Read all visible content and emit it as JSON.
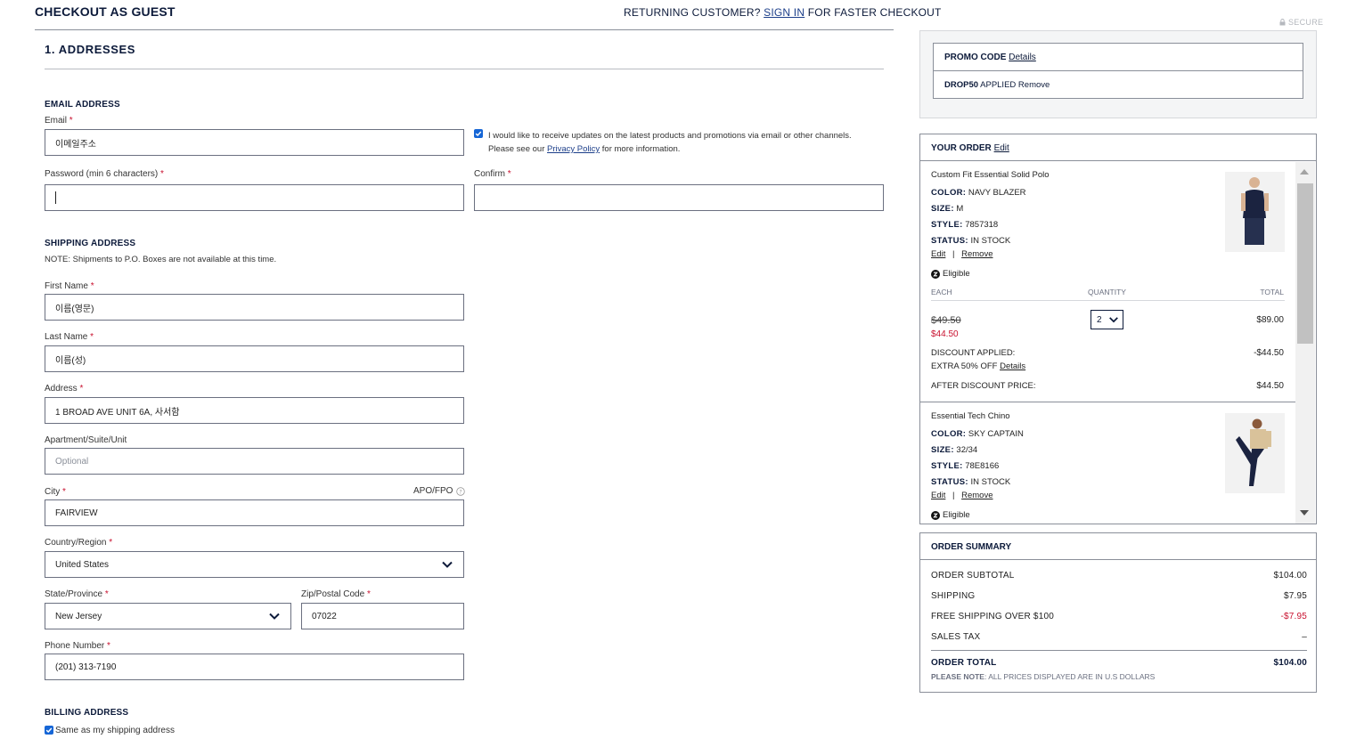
{
  "header": {
    "title": "CHECKOUT AS GUEST",
    "returning_prefix": "RETURNING CUSTOMER?",
    "sign_in": "SIGN IN",
    "returning_suffix": "FOR FASTER CHECKOUT"
  },
  "addresses": {
    "section_title": "1. ADDRESSES",
    "email_heading": "EMAIL ADDRESS",
    "email_label": "Email",
    "email_value": "이메일주소",
    "optin_text": "I would like to receive updates on the latest products and promotions via email or other channels.",
    "optin_text2_prefix": "Please see our",
    "privacy_link": "Privacy Policy",
    "optin_text2_suffix": "for more information.",
    "password_label": "Password (min 6 characters)",
    "password_value": "",
    "confirm_label": "Confirm",
    "confirm_value": "",
    "shipping_heading": "SHIPPING ADDRESS",
    "shipping_note": "NOTE: Shipments to P.O. Boxes are not available at this time.",
    "first_name_label": "First Name",
    "first_name_value": "이름(영문)",
    "last_name_label": "Last Name",
    "last_name_value": "이름(성)",
    "address_label": "Address",
    "address_value": "1 BROAD AVE UNIT 6A, 사서함",
    "apt_label": "Apartment/Suite/Unit",
    "apt_placeholder": "Optional",
    "city_label": "City",
    "apo_label": "APO/FPO",
    "city_value": "FAIRVIEW",
    "country_label": "Country/Region",
    "country_value": "United States",
    "state_label": "State/Province",
    "state_value": "New Jersey",
    "zip_label": "Zip/Postal Code",
    "zip_value": "07022",
    "phone_label": "Phone Number",
    "phone_value": "(201) 313-7190",
    "billing_heading": "BILLING ADDRESS",
    "same_as_shipping": "Same as my shipping address",
    "required_mark": "*"
  },
  "sidebar": {
    "secure": "SECURE",
    "promo_label": "PROMO CODE",
    "promo_details": "Details",
    "promo_code": "DROP50",
    "promo_applied": "APPLIED",
    "promo_remove": "Remove",
    "order_title": "YOUR ORDER",
    "order_edit": "Edit",
    "items": [
      {
        "name": "Custom Fit Essential Solid Polo",
        "color_key": "COLOR:",
        "color": "NAVY BLAZER",
        "size_key": "SIZE:",
        "size": "M",
        "style_key": "STYLE:",
        "style": "7857318",
        "status_key": "STATUS:",
        "status": "IN STOCK",
        "edit": "Edit",
        "remove": "Remove",
        "eligible": "Eligible",
        "each_head": "EACH",
        "qty_head": "QUANTITY",
        "total_head": "TOTAL",
        "orig_price": "$49.50",
        "sale_price": "$44.50",
        "quantity": "2",
        "total": "$89.00",
        "discount_label": "DISCOUNT APPLIED:",
        "discount_value": "-$44.50",
        "discount_desc": "EXTRA 50% OFF",
        "discount_details": "Details",
        "after_label": "AFTER DISCOUNT PRICE:",
        "after_value": "$44.50"
      },
      {
        "name": "Essential Tech Chino",
        "color_key": "COLOR:",
        "color": "SKY CAPTAIN",
        "size_key": "SIZE:",
        "size": "32/34",
        "style_key": "STYLE:",
        "style": "78E8166",
        "status_key": "STATUS:",
        "status": "IN STOCK",
        "edit": "Edit",
        "remove": "Remove",
        "eligible": "Eligible"
      }
    ],
    "summary": {
      "title": "ORDER SUMMARY",
      "rows": [
        {
          "label": "ORDER SUBTOTAL",
          "value": "$104.00"
        },
        {
          "label": "SHIPPING",
          "value": "$7.95"
        },
        {
          "label": "FREE SHIPPING OVER $100",
          "value": "-$7.95"
        },
        {
          "label": "SALES TAX",
          "value": "–"
        }
      ],
      "total_label": "ORDER TOTAL",
      "total_value": "$104.00",
      "note_bold": "PLEASE NOTE",
      "note_text": ": ALL PRICES DISPLAYED ARE IN U.S DOLLARS"
    }
  },
  "colors": {
    "navy": "#0c1a3a",
    "red": "#c8102e",
    "link": "#1d3f8a",
    "checkbox": "#1666d6"
  }
}
